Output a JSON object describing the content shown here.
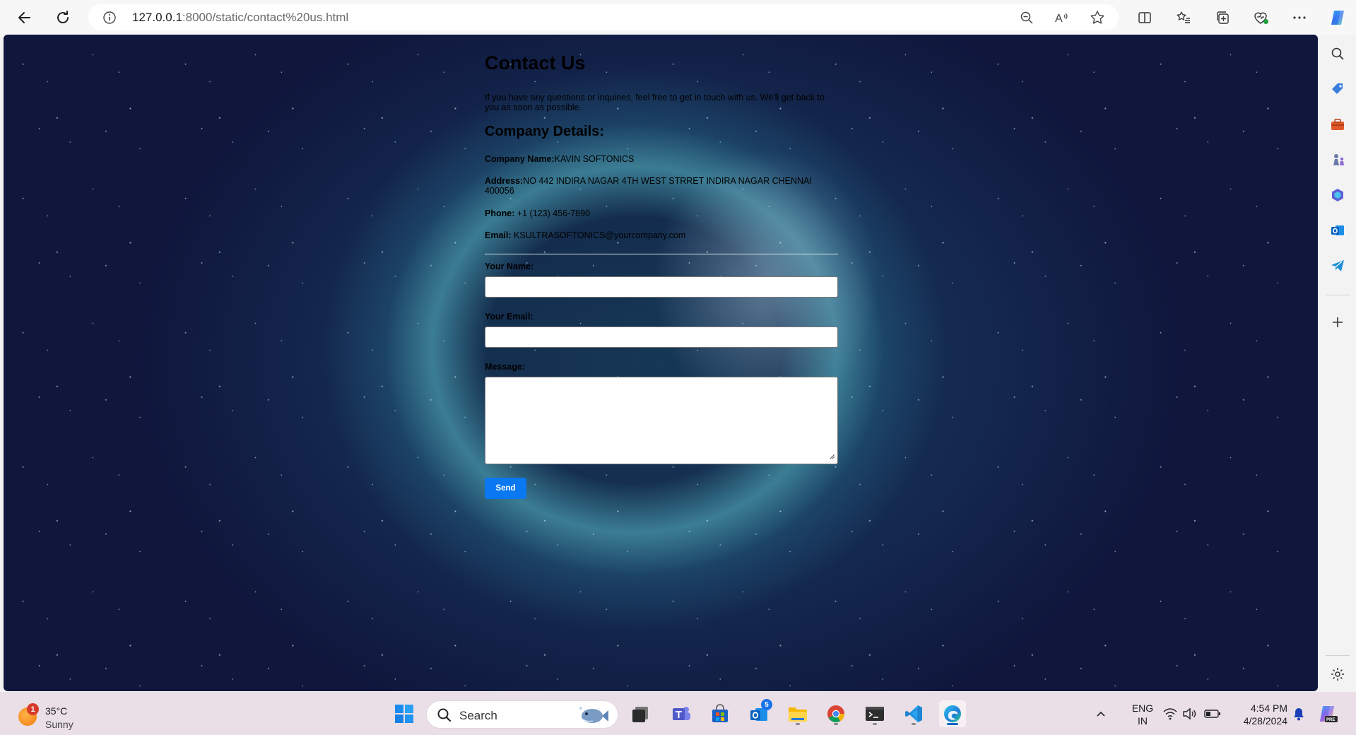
{
  "browser": {
    "url_host": "127.0.0.1",
    "url_rest": ":8000/static/contact%20us.html"
  },
  "page": {
    "title": "Contact Us",
    "intro": "If you have any questions or inquiries, feel free to get in touch with us. We'll get back to you as soon as possible.",
    "company_heading": "Company Details:",
    "company_name_label": "Company Name:",
    "company_name": "KAVIN SOFTONICS",
    "address_label": "Address:",
    "address": "NO 442 INDIRA NAGAR 4TH WEST STRRET INDIRA NAGAR CHENNAI 400056",
    "phone_label": "Phone:",
    "phone": " +1 (123) 456-7890",
    "email_label": "Email:",
    "email": " KSULTRASOFTONICS@yourcompany.com",
    "form": {
      "name_label": "Your Name:",
      "name_value": "",
      "email_label": "Your Email:",
      "email_value": "",
      "message_label": "Message:",
      "message_value": "",
      "send_label": "Send"
    }
  },
  "taskbar": {
    "weather_badge": "1",
    "temperature": "35°C",
    "condition": "Sunny",
    "search_placeholder": "Search",
    "outlook_badge": "5",
    "lang_top": "ENG",
    "lang_bottom": "IN",
    "time": "4:54 PM",
    "date": "4/28/2024"
  },
  "colors": {
    "send_button": "#0a78f0",
    "taskbar": "#eadfe6",
    "active_indicator": "#0067c0"
  }
}
